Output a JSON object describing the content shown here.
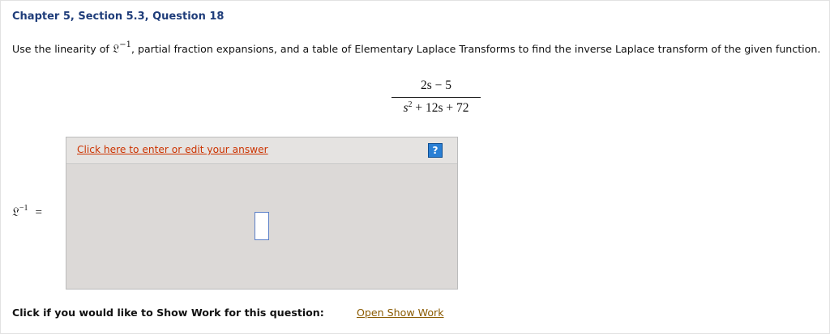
{
  "header": {
    "title": "Chapter 5, Section 5.3, Question 18"
  },
  "question": {
    "text_before": "Use the linearity of",
    "operator_symbol": "𝔏",
    "operator_exponent": "−1",
    "text_after": ", partial fraction expansions, and a table of Elementary Laplace Transforms to find the inverse Laplace transform of the given function."
  },
  "expression": {
    "numerator": "2s − 5",
    "denominator": {
      "s": "s",
      "exponent": "2",
      "rest": " + 12s + 72"
    }
  },
  "answer": {
    "lhs_symbol": "𝔏",
    "lhs_exponent": "−1",
    "equals": "=",
    "edit_link_label": "Click here to enter or edit your answer",
    "help_label": "?"
  },
  "footer": {
    "show_work_prompt": "Click if you would like to Show Work for this question:",
    "open_show_work_label": "Open Show Work"
  },
  "colors": {
    "title": "#1f3d7a",
    "edit_link": "#cc3300",
    "show_work_link": "#8a5a00",
    "help_button": "#2a7fd4",
    "answer_area": "#dcd9d7"
  }
}
